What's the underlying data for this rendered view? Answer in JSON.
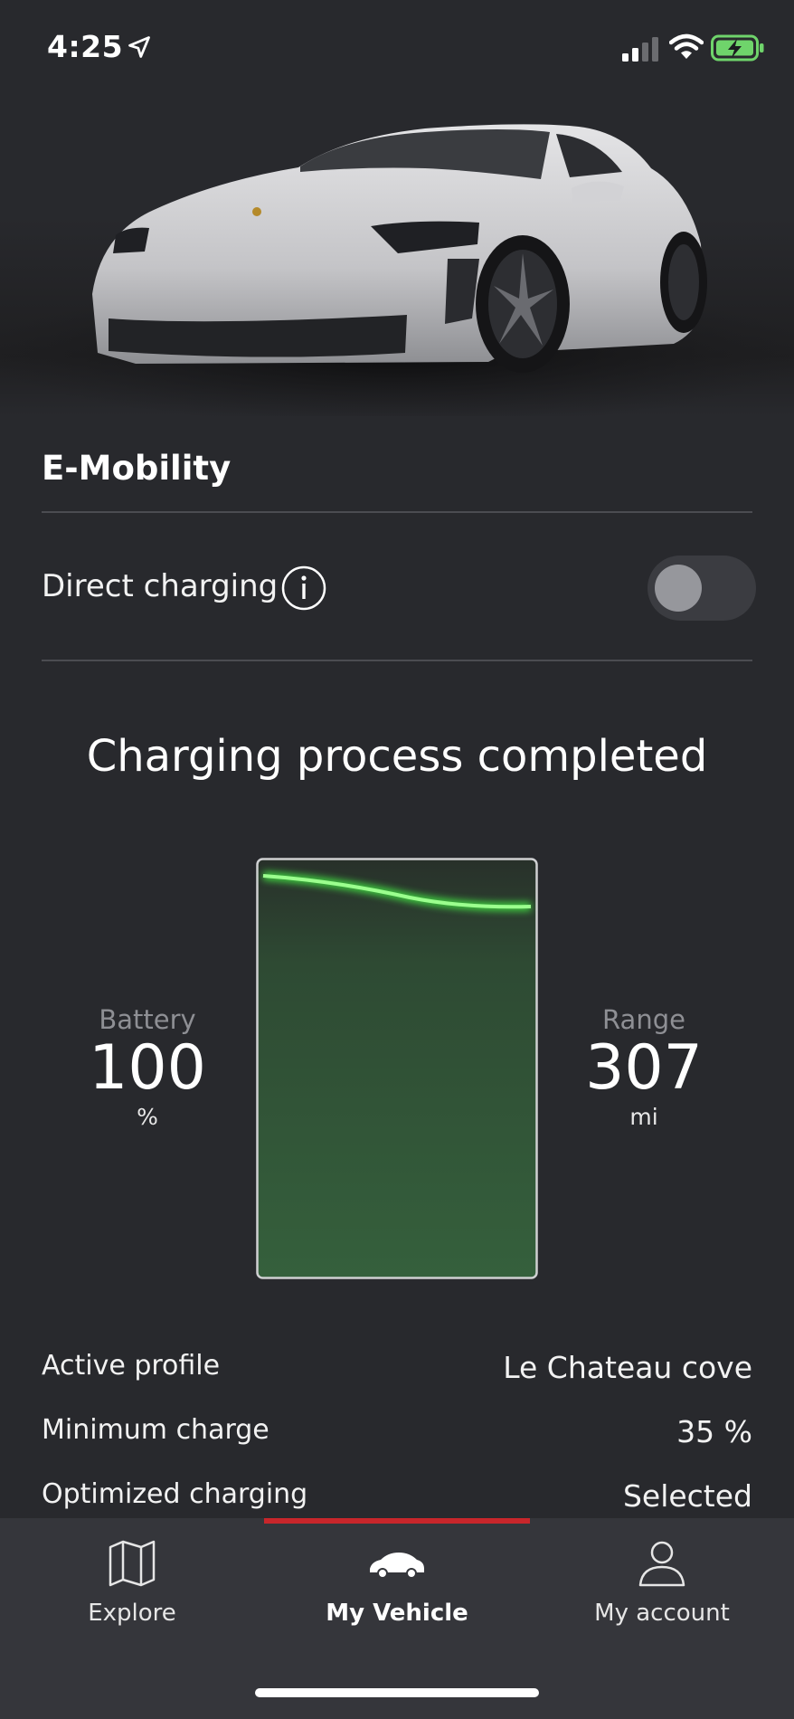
{
  "status_bar": {
    "time": "4:25"
  },
  "section": {
    "title": "E-Mobility"
  },
  "direct_charging": {
    "label": "Direct charging",
    "enabled": false
  },
  "charging": {
    "status_title": "Charging process completed",
    "battery": {
      "label": "Battery",
      "value": "100",
      "unit": "%"
    },
    "range": {
      "label": "Range",
      "value": "307",
      "unit": "mi"
    }
  },
  "details": [
    {
      "label": "Active profile",
      "value": "Le Chateau cove"
    },
    {
      "label": "Minimum charge",
      "value": "35 %"
    },
    {
      "label": "Optimized charging",
      "value": "Selected"
    }
  ],
  "tabs": [
    {
      "label": "Explore",
      "icon": "map-icon",
      "active": false
    },
    {
      "label": "My Vehicle",
      "icon": "car-icon",
      "active": true
    },
    {
      "label": "My account",
      "icon": "person-icon",
      "active": false
    }
  ],
  "colors": {
    "accent_red": "#c8262b",
    "charge_green": "#35603c",
    "charge_line": "#4cf04c",
    "background": "#28292d"
  }
}
